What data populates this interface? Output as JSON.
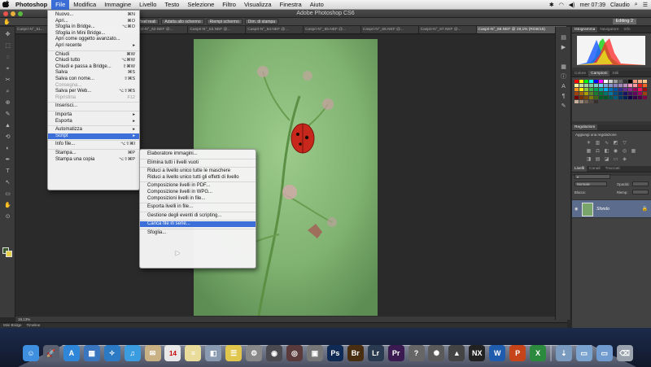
{
  "menubar": {
    "apple": "",
    "items": [
      "Photoshop",
      "File",
      "Modifica",
      "Immagine",
      "Livello",
      "Testo",
      "Selezione",
      "Filtro",
      "Visualizza",
      "Finestra",
      "Aiuto"
    ],
    "active_index": 1,
    "clock": "mer 07:39",
    "user": "Claudio"
  },
  "window": {
    "title": "Adobe Photoshop CS6"
  },
  "optionsbar": {
    "buttons": [
      "Pixel reali",
      "Adatta allo schermo",
      "Riempi schermo",
      "Dim. di stampa"
    ],
    "workspace": "Editing 2"
  },
  "tabs": [
    "Caspri-N°_51...",
    "Caspri-N°_61.NEF @...",
    "Caspri-N°_62.NEF @...",
    "Caspri-N°_63.NEF @...",
    "Caspri-N°_64.NEF @...",
    "Caspri-N°_65.NEF @...",
    "Caspri-N°_66.NEF @...",
    "Caspri-N°_67.NEF @...",
    "Caspri-N°_68.NEF @ 19,1% (RGB/16)"
  ],
  "tools": [
    "✥",
    "⬚",
    "◌",
    "⌖",
    "✂",
    "⌕",
    "⊕",
    "✎",
    "▲",
    "⟲",
    "◐",
    "✒",
    "T",
    "↖",
    "▭",
    "✋",
    "⊙"
  ],
  "file_menu": [
    {
      "label": "Nuovo...",
      "shortcut": "⌘N"
    },
    {
      "label": "Apri...",
      "shortcut": "⌘O"
    },
    {
      "label": "Sfoglia in Bridge...",
      "shortcut": "⌥⌘O"
    },
    {
      "label": "Sfoglia in Mini Bridge...",
      "shortcut": ""
    },
    {
      "label": "Apri come oggetto avanzato...",
      "shortcut": ""
    },
    {
      "label": "Apri recente",
      "shortcut": "▸"
    },
    {
      "sep": true
    },
    {
      "label": "Chiudi",
      "shortcut": "⌘W"
    },
    {
      "label": "Chiudi tutto",
      "shortcut": "⌥⌘W"
    },
    {
      "label": "Chiudi e passa a Bridge...",
      "shortcut": "⇧⌘W"
    },
    {
      "label": "Salva",
      "shortcut": "⌘S"
    },
    {
      "label": "Salva con nome...",
      "shortcut": "⇧⌘S"
    },
    {
      "label": "Consegna...",
      "shortcut": "",
      "disabled": true
    },
    {
      "label": "Salva per Web...",
      "shortcut": "⌥⇧⌘S"
    },
    {
      "label": "Ripristina",
      "shortcut": "F12",
      "disabled": true
    },
    {
      "sep": true
    },
    {
      "label": "Inserisci...",
      "shortcut": ""
    },
    {
      "sep": true
    },
    {
      "label": "Importa",
      "shortcut": "▸"
    },
    {
      "label": "Esporta",
      "shortcut": "▸"
    },
    {
      "sep": true
    },
    {
      "label": "Automatizza",
      "shortcut": "▸"
    },
    {
      "label": "Script",
      "shortcut": "▸",
      "highlight": true
    },
    {
      "sep": true
    },
    {
      "label": "Info file...",
      "shortcut": "⌥⇧⌘I"
    },
    {
      "sep": true
    },
    {
      "label": "Stampa...",
      "shortcut": "⌘P"
    },
    {
      "label": "Stampa una copia",
      "shortcut": "⌥⇧⌘P"
    }
  ],
  "script_menu": [
    {
      "label": "Elaboratore immagini..."
    },
    {
      "sep": true
    },
    {
      "label": "Elimina tutti i livelli vuoti"
    },
    {
      "sep": true
    },
    {
      "label": "Riduci a livello unico tutte le maschere"
    },
    {
      "label": "Riduci a livello unico tutti gli effetti di livello"
    },
    {
      "sep": true
    },
    {
      "label": "Composizione livelli in PDF..."
    },
    {
      "label": "Composizione livelli in WPG..."
    },
    {
      "label": "Composizioni livelli in file..."
    },
    {
      "sep": true
    },
    {
      "label": "Esporta livelli in file..."
    },
    {
      "sep": true
    },
    {
      "label": "Gestione degli eventi di scripting..."
    },
    {
      "sep": true
    },
    {
      "label": "Carica file in serie...",
      "highlight": true
    },
    {
      "sep": true
    },
    {
      "label": "Sfoglia..."
    }
  ],
  "status": {
    "zoom": "19,13%"
  },
  "bottom_tabs": [
    "Mini Bridge",
    "Timeline"
  ],
  "panels": {
    "histogram_tabs": [
      "Istogramma",
      "Navigatore",
      "Info"
    ],
    "color_tabs": [
      "Colore",
      "Campioni",
      "Stili"
    ],
    "adjust_tab": "Regolazioni",
    "adjust_label": "Aggiungi una regolazione",
    "layers_tabs": [
      "Livelli",
      "Canali",
      "Tracciati"
    ],
    "blend_mode": "Normale",
    "opacity_label": "Opacità:",
    "lock_label": "Blocca:",
    "fill_label": "Riemp.:",
    "layer_name": "Sfondo"
  },
  "dock": {
    "icons": [
      {
        "name": "finder-icon",
        "glyph": "☺",
        "color": "#3f8fe0"
      },
      {
        "name": "launchpad-icon",
        "glyph": "🚀",
        "color": "#5a6070"
      },
      {
        "name": "appstore-icon",
        "glyph": "A",
        "color": "#2f86d8"
      },
      {
        "name": "mission-control-icon",
        "glyph": "▦",
        "color": "#3a76c0"
      },
      {
        "name": "safari-icon",
        "glyph": "✧",
        "color": "#2d7ac4"
      },
      {
        "name": "itunes-icon",
        "glyph": "♫",
        "color": "#3b9ce0"
      },
      {
        "name": "mail-icon",
        "glyph": "✉",
        "color": "#c9b184"
      },
      {
        "name": "calendar-icon",
        "glyph": "14",
        "color": "#e8e8e8"
      },
      {
        "name": "notes-icon",
        "glyph": "≡",
        "color": "#e9dc9a"
      },
      {
        "name": "preview-icon",
        "glyph": "◧",
        "color": "#8a9ab0"
      },
      {
        "name": "reminders-icon",
        "glyph": "☰",
        "color": "#e0c64c"
      },
      {
        "name": "preferences-icon",
        "glyph": "⚙",
        "color": "#888"
      },
      {
        "name": "quicktime-icon",
        "glyph": "◉",
        "color": "#4a4a50"
      },
      {
        "name": "photo-booth-icon",
        "glyph": "◎",
        "color": "#5a3a3a"
      },
      {
        "name": "screen-capture-icon",
        "glyph": "▣",
        "color": "#777"
      },
      {
        "name": "photoshop-icon",
        "glyph": "Ps",
        "color": "#0f2a55"
      },
      {
        "name": "bridge-icon",
        "glyph": "Br",
        "color": "#4a2e12"
      },
      {
        "name": "lightroom-icon",
        "glyph": "Lr",
        "color": "#2a3a50"
      },
      {
        "name": "premiere-icon",
        "glyph": "Pr",
        "color": "#3a1a50"
      },
      {
        "name": "help-icon",
        "glyph": "?",
        "color": "#666"
      },
      {
        "name": "capture-icon",
        "glyph": "✺",
        "color": "#5a5a5a"
      },
      {
        "name": "camera-icon",
        "glyph": "▲",
        "color": "#444"
      },
      {
        "name": "capture-nx2-icon",
        "glyph": "NX",
        "color": "#222"
      },
      {
        "name": "word-icon",
        "glyph": "W",
        "color": "#1f5cae"
      },
      {
        "name": "powerpoint-icon",
        "glyph": "P",
        "color": "#c5441a"
      },
      {
        "name": "excel-icon",
        "glyph": "X",
        "color": "#2b8a3e"
      },
      {
        "name": "separator-icon",
        "glyph": "",
        "color": "transparent"
      },
      {
        "name": "downloads-icon",
        "glyph": "⇣",
        "color": "#7a9ac0"
      },
      {
        "name": "documents-icon",
        "glyph": "▭",
        "color": "#7aa3cf"
      },
      {
        "name": "folder-icon",
        "glyph": "▭",
        "color": "#6f9bd0"
      },
      {
        "name": "trash-icon",
        "glyph": "⌫",
        "color": "#9aa3ad"
      }
    ]
  }
}
